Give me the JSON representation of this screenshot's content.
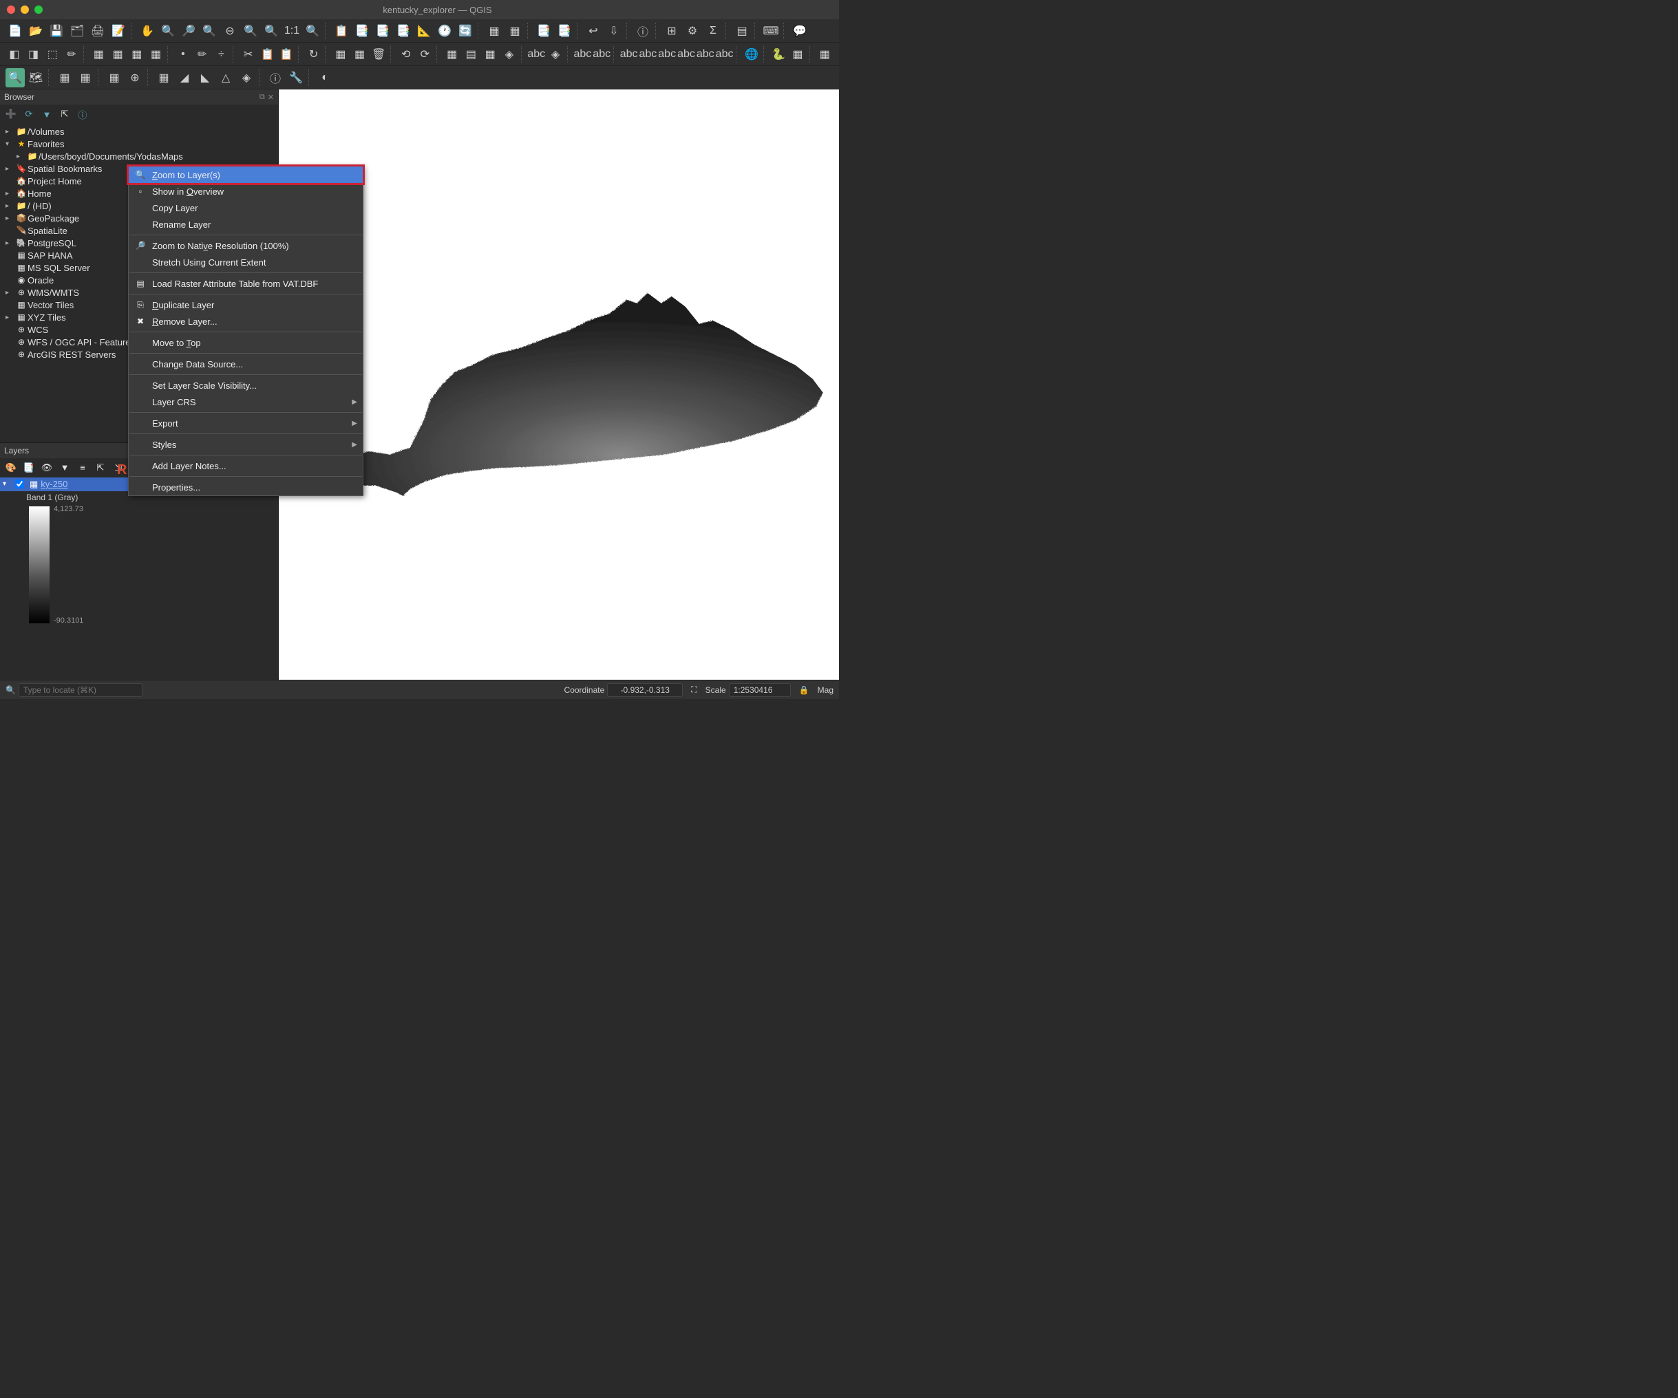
{
  "window": {
    "title": "kentucky_explorer — QGIS"
  },
  "browser": {
    "title": "Browser",
    "items": [
      {
        "icon": "▸",
        "ticon": "📁",
        "label": "/Volumes",
        "indent": 0
      },
      {
        "icon": "▾",
        "ticon": "★",
        "label": "Favorites",
        "indent": 0,
        "star": true
      },
      {
        "icon": "▸",
        "ticon": "📁",
        "label": "/Users/boyd/Documents/YodasMaps",
        "indent": 1
      },
      {
        "icon": "▸",
        "ticon": "🔖",
        "label": "Spatial Bookmarks",
        "indent": 0
      },
      {
        "icon": "",
        "ticon": "🏠",
        "label": "Project Home",
        "indent": 0
      },
      {
        "icon": "▸",
        "ticon": "🏠",
        "label": "Home",
        "indent": 0
      },
      {
        "icon": "▸",
        "ticon": "📁",
        "label": "/ (HD)",
        "indent": 0
      },
      {
        "icon": "▸",
        "ticon": "📦",
        "label": "GeoPackage",
        "indent": 0
      },
      {
        "icon": "",
        "ticon": "🪶",
        "label": "SpatiaLite",
        "indent": 0
      },
      {
        "icon": "▸",
        "ticon": "🐘",
        "label": "PostgreSQL",
        "indent": 0
      },
      {
        "icon": "",
        "ticon": "▦",
        "label": "SAP HANA",
        "indent": 0
      },
      {
        "icon": "",
        "ticon": "▦",
        "label": "MS SQL Server",
        "indent": 0
      },
      {
        "icon": "",
        "ticon": "◉",
        "label": "Oracle",
        "indent": 0
      },
      {
        "icon": "▸",
        "ticon": "⊕",
        "label": "WMS/WMTS",
        "indent": 0
      },
      {
        "icon": "",
        "ticon": "▦",
        "label": "Vector Tiles",
        "indent": 0
      },
      {
        "icon": "▸",
        "ticon": "▦",
        "label": "XYZ Tiles",
        "indent": 0
      },
      {
        "icon": "",
        "ticon": "⊕",
        "label": "WCS",
        "indent": 0
      },
      {
        "icon": "",
        "ticon": "⊕",
        "label": "WFS / OGC API - Features",
        "indent": 0
      },
      {
        "icon": "",
        "ticon": "⊕",
        "label": "ArcGIS REST Servers",
        "indent": 0
      }
    ]
  },
  "layers": {
    "title": "Layers",
    "layer_name": "ky-250",
    "band_label": "Band 1 (Gray)",
    "max_value": "4,123.73",
    "min_value": "-90.3101"
  },
  "context_menu": {
    "items": [
      {
        "label_html": "<span class='underline'>Z</span>oom to Layer(s)",
        "icon": "🔍",
        "highlighted": true
      },
      {
        "label_html": "Show in <span class='underline'>O</span>verview",
        "icon": "▫"
      },
      {
        "label_html": "Copy Layer",
        "icon": ""
      },
      {
        "label_html": "Rename Layer",
        "icon": ""
      },
      {
        "sep": true
      },
      {
        "label_html": "Zoom to Nati<span class='underline'>v</span>e Resolution (100%)",
        "icon": "🔎"
      },
      {
        "label_html": "Stretch Using Current Extent",
        "icon": ""
      },
      {
        "sep": true
      },
      {
        "label_html": "Load Raster Attribute Table from VAT.DBF",
        "icon": "▤"
      },
      {
        "sep": true
      },
      {
        "label_html": "<span class='underline'>D</span>uplicate Layer",
        "icon": "⎘"
      },
      {
        "label_html": "<span class='underline'>R</span>emove Layer...",
        "icon": "✖"
      },
      {
        "sep": true
      },
      {
        "label_html": "Move to <span class='underline'>T</span>op",
        "icon": ""
      },
      {
        "sep": true
      },
      {
        "label_html": "Change Data Source...",
        "icon": ""
      },
      {
        "sep": true
      },
      {
        "label_html": "Set Layer Scale Visibility...",
        "icon": ""
      },
      {
        "label_html": "Layer CRS",
        "icon": "",
        "submenu": true
      },
      {
        "sep": true
      },
      {
        "label_html": "Export",
        "icon": "",
        "submenu": true
      },
      {
        "sep": true
      },
      {
        "label_html": "Styles",
        "icon": "",
        "submenu": true
      },
      {
        "sep": true
      },
      {
        "label_html": "Add Layer Notes...",
        "icon": ""
      },
      {
        "sep": true
      },
      {
        "label_html": "Properties...",
        "icon": ""
      }
    ]
  },
  "annotation": {
    "text": "Right-click layer"
  },
  "statusbar": {
    "locate_placeholder": "Type to locate (⌘K)",
    "coordinate_label": "Coordinate",
    "coordinate_value": "-0.932,-0.313",
    "scale_label": "Scale",
    "scale_value": "1:2530416",
    "mag_label": "Mag"
  },
  "toolbar_icons": {
    "row1": [
      "📄",
      "📂",
      "💾",
      "🗂",
      "🖨",
      "📝",
      "⋮",
      "✋",
      "🔍",
      "🔎",
      "🔍",
      "⊖",
      "🔍",
      "🔍",
      "1:1",
      "🔍",
      "⋮",
      "📋",
      "📑",
      "📑",
      "📑",
      "📐",
      "🕐",
      "🔄",
      "⋮",
      "▦",
      "▦",
      "⋮",
      "📑",
      "📑",
      "⋮",
      "↩",
      "⇩",
      "⋮",
      "ⓘ",
      "⋮",
      "⊞",
      "⚙",
      "Σ",
      "⋮",
      "▤",
      "⋮",
      "⌨",
      "⋮",
      "💬"
    ],
    "row2": [
      "◧",
      "◨",
      "⬚",
      "✏",
      "⋮",
      "▦",
      "▦",
      "▦",
      "▦",
      "⋮",
      "•",
      "✏",
      "÷",
      "⋮",
      "✂",
      "📋",
      "📋",
      "⋮",
      "↻",
      "⋮",
      "▦",
      "▦",
      "🗑",
      "⋮",
      "⟲",
      "⟳",
      "⋮",
      "▦",
      "▤",
      "▦",
      "◈",
      "⋮",
      "abc",
      "◈",
      "⋮",
      "abc",
      "abc",
      "⋮",
      "abc",
      "abc",
      "abc",
      "abc",
      "abc",
      "abc",
      "⋮",
      "🌐",
      "⋮",
      "🐍",
      "▦",
      "⋮",
      "▦"
    ],
    "row3": [
      "🔍",
      "🗺",
      "⋮",
      "▦",
      "▦",
      "⋮",
      "▦",
      "⊕",
      "⋮",
      "▦",
      "◢",
      "◣",
      "△",
      "◈",
      "⋮",
      "ⓘ",
      "🔧",
      "⋮",
      "◐"
    ]
  }
}
